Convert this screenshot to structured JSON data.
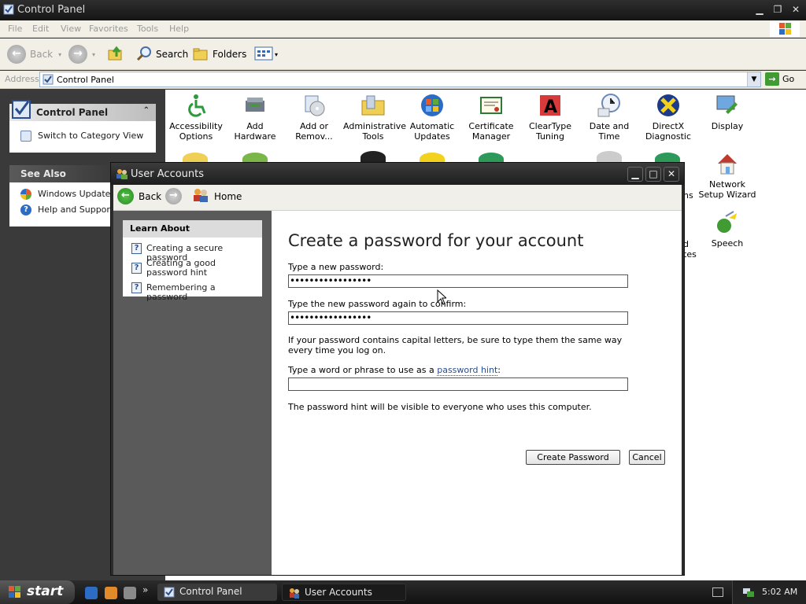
{
  "window": {
    "title": "Control Panel"
  },
  "menu": [
    "File",
    "Edit",
    "View",
    "Favorites",
    "Tools",
    "Help"
  ],
  "toolbar": {
    "back": "Back",
    "search": "Search",
    "folders": "Folders"
  },
  "address": {
    "label": "Address",
    "value": "Control Panel",
    "go": "Go"
  },
  "taskpane": {
    "panel_title": "Control Panel",
    "switch_view": "Switch to Category View",
    "see_also_title": "See Also",
    "windows_update": "Windows Update",
    "help_support": "Help and Support"
  },
  "cp_icons": [
    {
      "label": "Accessibility Options"
    },
    {
      "label": "Add Hardware"
    },
    {
      "label": "Add or Remov..."
    },
    {
      "label": "Administrative Tools"
    },
    {
      "label": "Automatic Updates"
    },
    {
      "label": "Certificate Manager"
    },
    {
      "label": "ClearType Tuning"
    },
    {
      "label": "Date and Time"
    },
    {
      "label": "DirectX Diagnostic"
    },
    {
      "label": "Display"
    },
    {
      "label": "Network Setup Wizard"
    },
    {
      "label": "Speech"
    }
  ],
  "cp_partial_labels": {
    "ns": "ns",
    "d_tes": "d\ntes"
  },
  "ua": {
    "title": "User Accounts",
    "nav": {
      "back": "Back",
      "home": "Home"
    },
    "learn_about": {
      "title": "Learn About",
      "links": [
        "Creating a secure password",
        "Creating a good password hint",
        "Remembering a password"
      ]
    },
    "heading": "Create a password for your account",
    "new_password_label": "Type a new password:",
    "new_password_value": "•••••••••••••••••",
    "confirm_label": "Type the new password again to confirm:",
    "confirm_value": "•••••••••••••••••",
    "caps_note": "If your password contains capital letters, be sure to type them the same way every time you log on.",
    "hint_label_prefix": "Type a word or phrase to use as a ",
    "hint_label_link": "password hint",
    "hint_label_suffix": ":",
    "hint_value": "",
    "hint_note": "The password hint will be visible to everyone who uses this computer.",
    "create_button": "Create Password",
    "cancel_button": "Cancel"
  },
  "taskbar": {
    "start": "start",
    "tasks": [
      "Control Panel",
      "User Accounts"
    ],
    "clock": "5:02 AM"
  }
}
